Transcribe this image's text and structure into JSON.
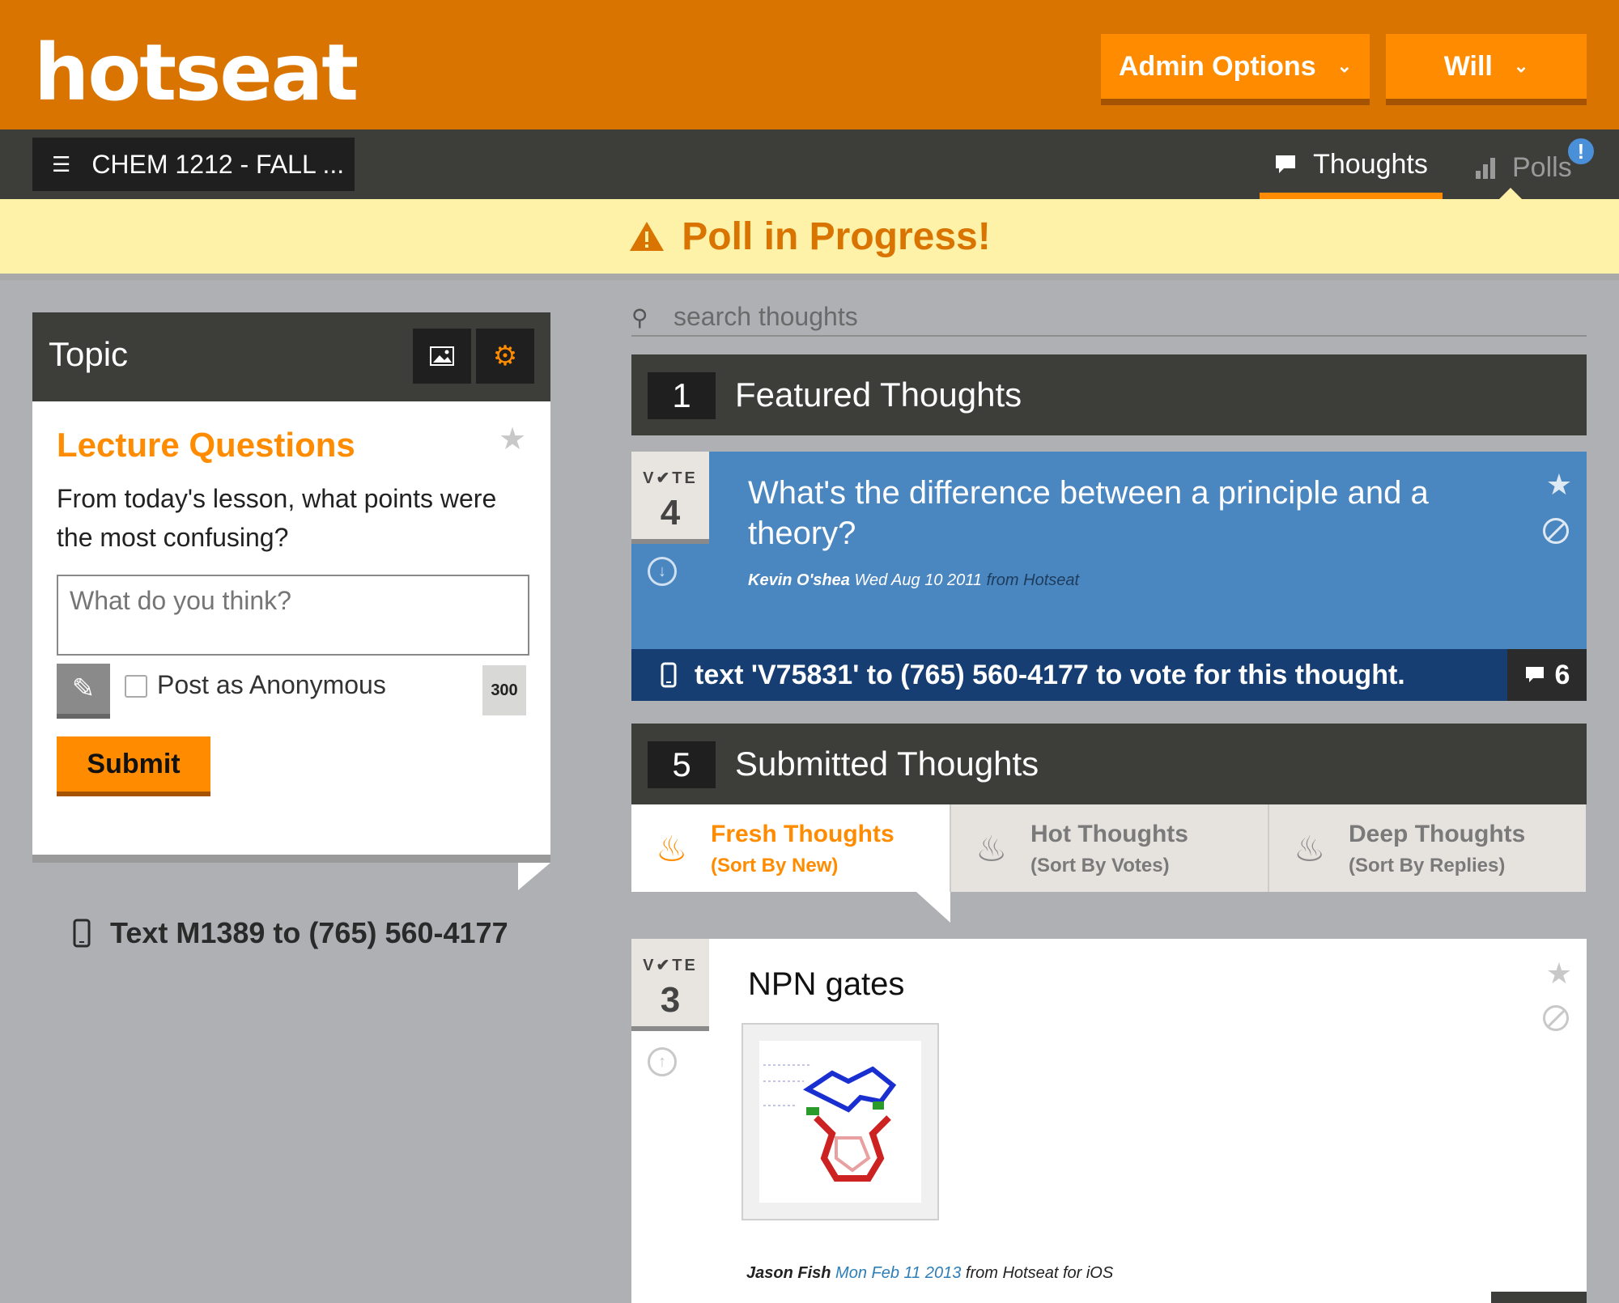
{
  "header": {
    "logo_text": "hotseat",
    "admin_button": "Admin Options",
    "user_button": "Will",
    "brand_color": "#d97400",
    "accent_color": "#ff8c00"
  },
  "subnav": {
    "course": "CHEM 1212 - FALL ...",
    "tabs": [
      {
        "label": "Thoughts",
        "icon": "speech-bubble-icon",
        "active": true
      },
      {
        "label": "Polls",
        "icon": "bar-chart-icon",
        "active": false
      }
    ],
    "polls_badge": "!"
  },
  "alert": {
    "icon": "warning-icon",
    "text": "Poll in Progress!"
  },
  "topic": {
    "header": "Topic",
    "title": "Lecture Questions",
    "description": "From today's lesson, what points were the most confusing?",
    "answer_placeholder": "What do you think?",
    "anonymous_label": "Post as Anonymous",
    "char_count": "300",
    "submit_label": "Submit",
    "text_instruction": "Text M1389 to (765) 560-4177"
  },
  "search": {
    "placeholder": "search thoughts"
  },
  "featured": {
    "count": "1",
    "title": "Featured Thoughts",
    "card": {
      "vote_label": "V✔TE",
      "votes": "4",
      "question": "What's the difference between a principle and a theory?",
      "author": "Kevin O'shea",
      "date": "Wed Aug 10 2011",
      "source": "from Hotseat",
      "sms_text": "text 'V75831' to (765) 560-4177 to vote for this thought.",
      "reply_count": "6"
    }
  },
  "submitted": {
    "count": "5",
    "title": "Submitted Thoughts",
    "sort_tabs": [
      {
        "name": "Fresh Thoughts",
        "sub": "(Sort By New)",
        "active": true
      },
      {
        "name": "Hot Thoughts",
        "sub": "(Sort By Votes)",
        "active": false
      },
      {
        "name": "Deep Thoughts",
        "sub": "(Sort By Replies)",
        "active": false
      }
    ],
    "card": {
      "vote_label": "V✔TE",
      "votes": "3",
      "title": "NPN gates",
      "author": "Jason Fish",
      "date": "Mon Feb 11 2013",
      "source": "from Hotseat for iOS"
    }
  }
}
